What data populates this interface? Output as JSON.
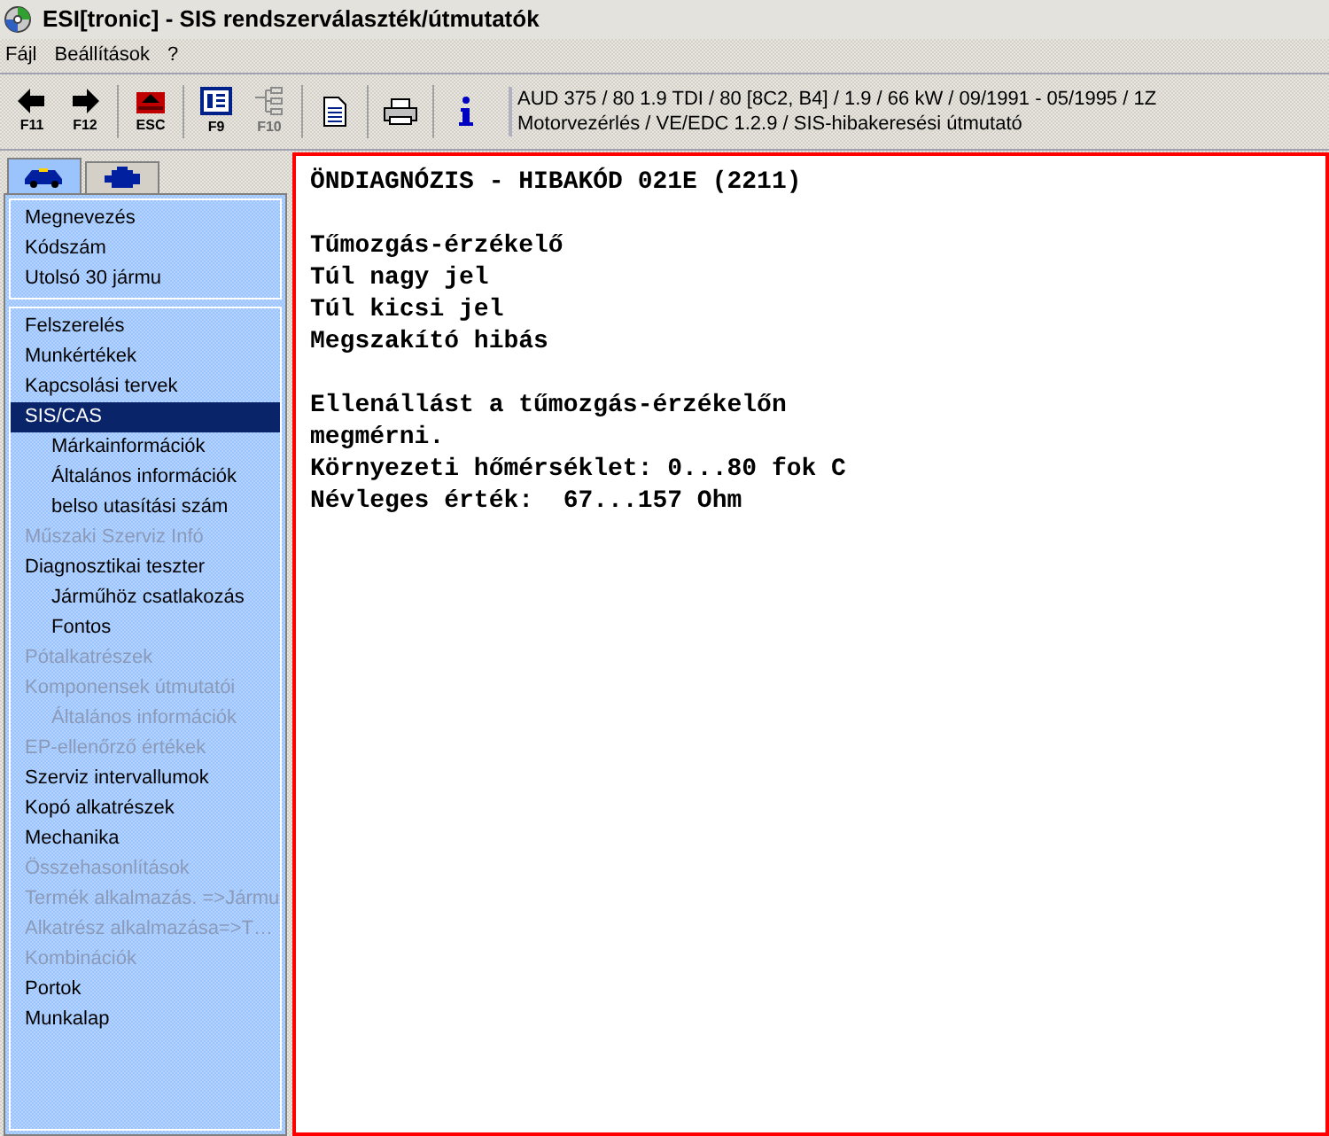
{
  "window": {
    "title": "ESI[tronic] - SIS rendszerválaszték/útmutatók"
  },
  "menu": [
    "Fájl",
    "Beállítások",
    "?"
  ],
  "toolbar": [
    {
      "kind": "back",
      "label": "F11",
      "disabled": false
    },
    {
      "kind": "forward",
      "label": "F12",
      "disabled": false
    },
    {
      "kind": "esc",
      "label": "ESC",
      "disabled": false
    },
    {
      "kind": "list",
      "label": "F9",
      "disabled": false
    },
    {
      "kind": "tree",
      "label": "F10",
      "disabled": true
    },
    {
      "kind": "document",
      "disabled": false
    },
    {
      "kind": "print",
      "disabled": false
    },
    {
      "kind": "info",
      "disabled": false
    }
  ],
  "vehicle_info": [
    "AUD 375 / 80 1.9 TDI / 80 [8C2, B4] / 1.9 / 66 kW / 09/1991 - 05/1995 / 1Z",
    "Motorvezérlés / VE/EDC 1.2.9 / SIS-hibakeresési útmutató"
  ],
  "tabs": [
    {
      "kind": "car",
      "selected": true
    },
    {
      "kind": "engine",
      "selected": false
    }
  ],
  "sidebar": {
    "groups": [
      [
        {
          "label": "Megnevezés",
          "selected": false,
          "disabled": false
        },
        {
          "label": "Kódszám",
          "selected": false,
          "disabled": false
        },
        {
          "label": "Utolsó 30 jármu",
          "selected": false,
          "disabled": false
        }
      ],
      [
        {
          "label": "Felszerelés",
          "selected": false,
          "disabled": false
        },
        {
          "label": "Munkértékek",
          "selected": false,
          "disabled": false
        },
        {
          "label": "Kapcsolási tervek",
          "selected": false,
          "disabled": false
        },
        {
          "label": "SIS/CAS",
          "selected": true,
          "disabled": false,
          "children": [
            {
              "label": "Márkainformációk",
              "selected": false,
              "disabled": false
            },
            {
              "label": "Általános információk",
              "selected": false,
              "disabled": false
            },
            {
              "label": "belso utasítási szám",
              "selected": false,
              "disabled": false
            }
          ]
        },
        {
          "label": "Műszaki Szerviz Infó",
          "selected": false,
          "disabled": true
        },
        {
          "label": "Diagnosztikai teszter",
          "selected": false,
          "disabled": false,
          "children": [
            {
              "label": "Járműhöz csatlakozás",
              "selected": false,
              "disabled": false
            },
            {
              "label": "Fontos",
              "selected": false,
              "disabled": false
            }
          ]
        },
        {
          "label": "Pótalkatrészek",
          "selected": false,
          "disabled": true
        },
        {
          "label": "Komponensek útmutatói",
          "selected": false,
          "disabled": true,
          "children": [
            {
              "label": "Általános információk",
              "selected": false,
              "disabled": true
            }
          ]
        },
        {
          "label": "EP-ellenőrző értékek",
          "selected": false,
          "disabled": true
        },
        {
          "label": "Szerviz intervallumok",
          "selected": false,
          "disabled": false
        },
        {
          "label": "Kopó alkatrészek",
          "selected": false,
          "disabled": false
        },
        {
          "label": "Mechanika",
          "selected": false,
          "disabled": false
        },
        {
          "label": "Összehasonlítások",
          "selected": false,
          "disabled": true
        },
        {
          "label": "Termék alkalmazás. =>Jármu",
          "selected": false,
          "disabled": true
        },
        {
          "label": "Alkatrész alkalmazása=>T…",
          "selected": false,
          "disabled": true
        },
        {
          "label": "Kombinációk",
          "selected": false,
          "disabled": true
        },
        {
          "label": "Portok",
          "selected": false,
          "disabled": false
        },
        {
          "label": "Munkalap",
          "selected": false,
          "disabled": false
        }
      ]
    ]
  },
  "document": {
    "title": "ÖNDIAGNÓZIS - HIBAKÓD 021E (2211)",
    "paragraphs": [
      [
        "Tűmozgás-érzékelő",
        "Túl nagy jel",
        "Túl kicsi jel",
        "Megszakító hibás"
      ],
      [
        "Ellenállást a tűmozgás-érzékelőn",
        "megmérni.",
        "Környezeti hőmérséklet: 0...80 fok C",
        "Névleges érték:  67...157 Ohm"
      ]
    ]
  }
}
